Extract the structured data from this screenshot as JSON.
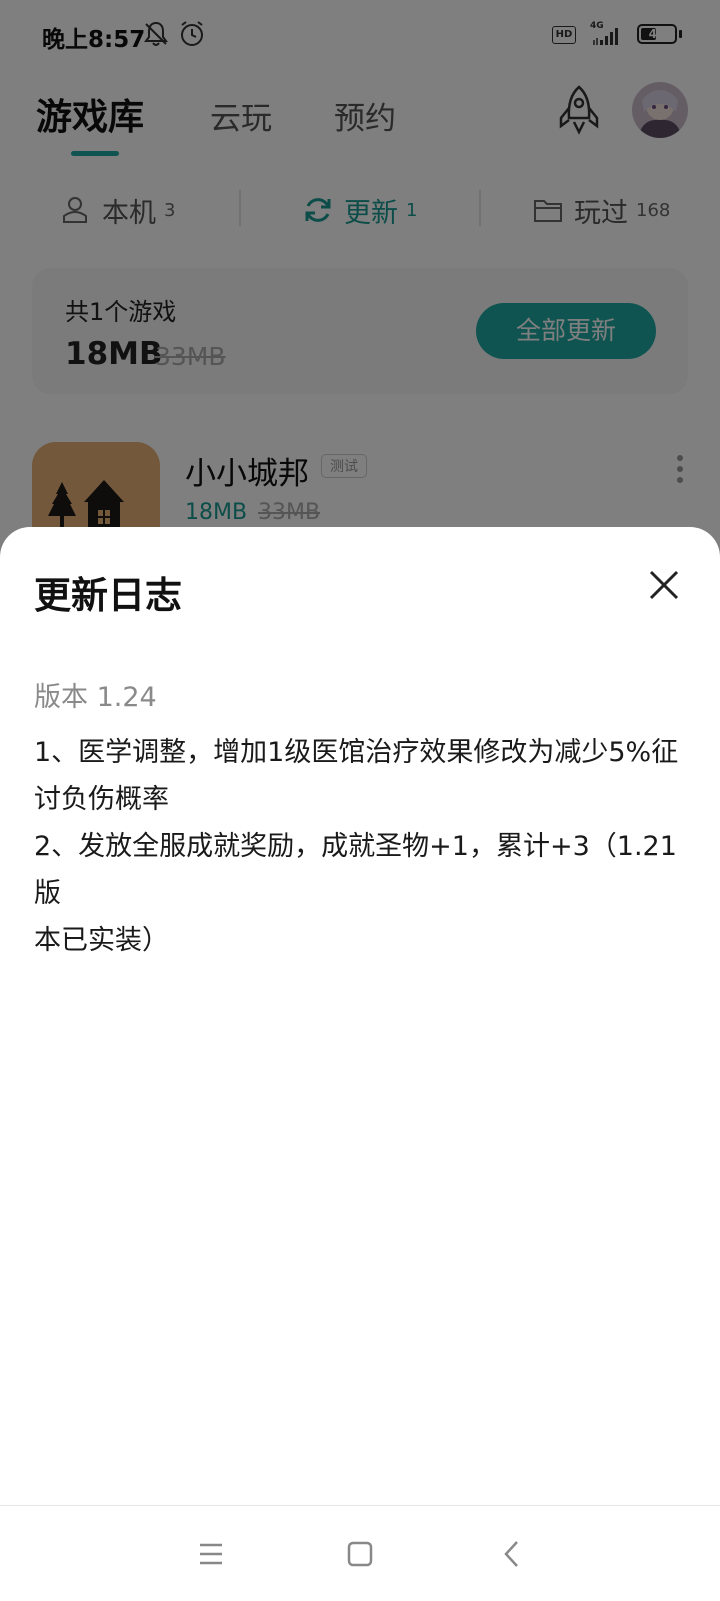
{
  "status_bar": {
    "time": "晚上8:57",
    "network": "4G",
    "hd": "HD",
    "battery": "47",
    "battery_level": 0.47
  },
  "header": {
    "tabs": [
      "游戏库",
      "云玩",
      "预约"
    ]
  },
  "subtabs": [
    {
      "label": "本机",
      "count": "3"
    },
    {
      "label": "更新",
      "count": "1"
    },
    {
      "label": "玩过",
      "count": "168"
    }
  ],
  "summary": {
    "count_text": "共1个游戏",
    "size": "18MB",
    "old_size": "33MB",
    "button": "全部更新"
  },
  "game": {
    "name": "小小城邦",
    "badge": "测试",
    "size": "18MB",
    "old_size": "33MB"
  },
  "sheet": {
    "title": "更新日志",
    "version": "版本 1.24",
    "lines": [
      "1、医学调整，增加1级医馆治疗效果修改为减少5%征",
      "讨负伤概率",
      "2、发放全服成就奖励，成就圣物+1，累计+3（1.21版",
      "本已实装）"
    ]
  },
  "colors": {
    "accent": "#1fa9a0",
    "overlay": "rgba(0,0,0,0.5)"
  }
}
